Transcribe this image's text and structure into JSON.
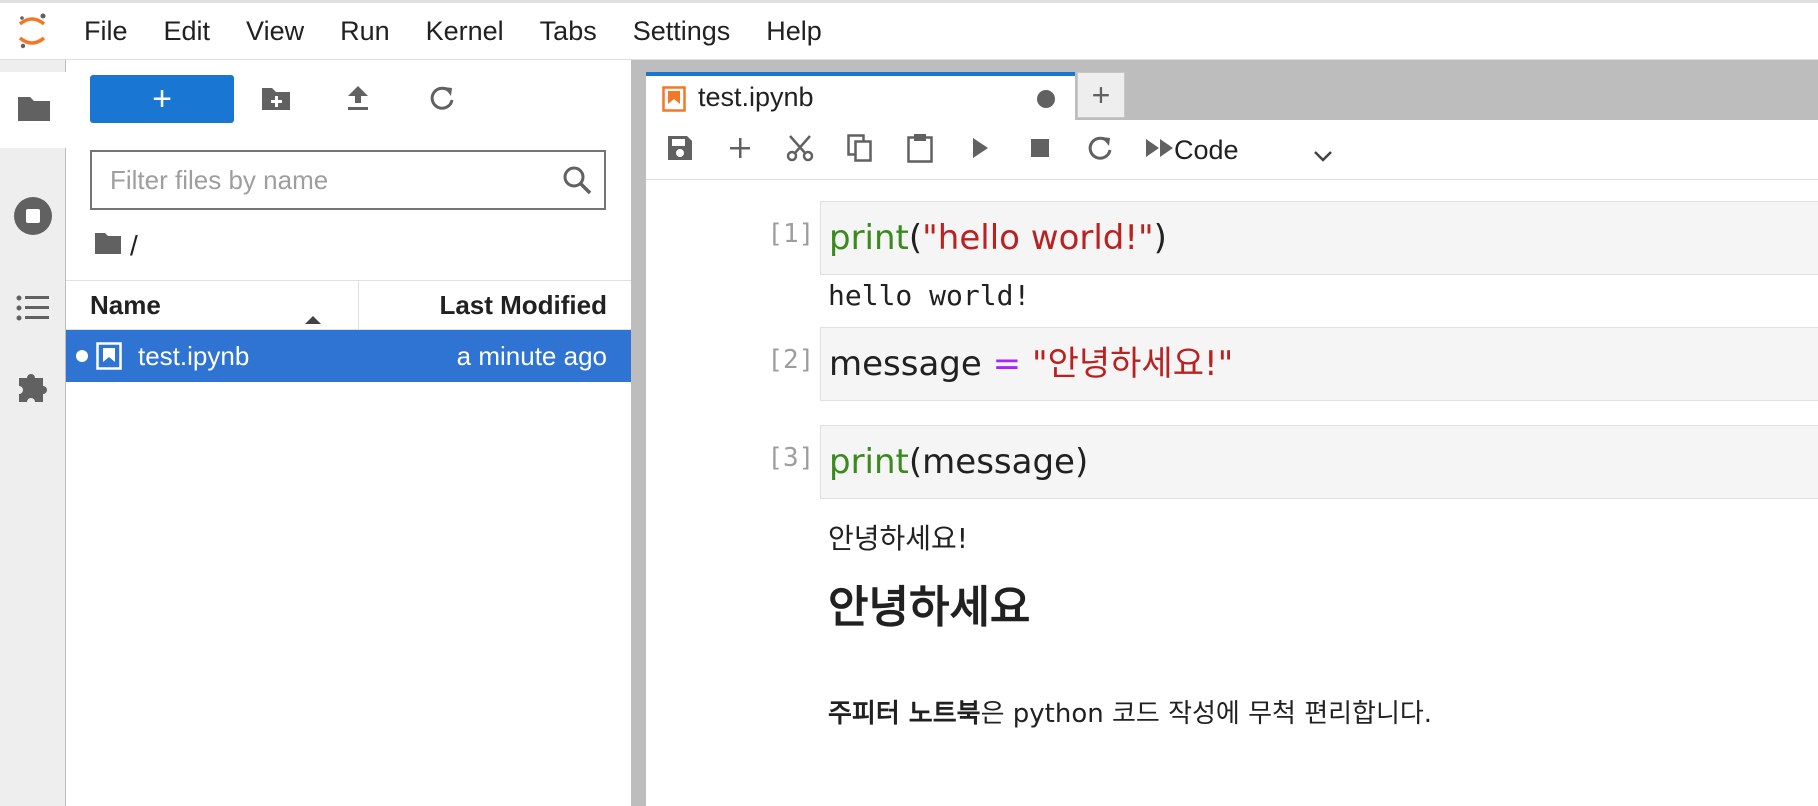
{
  "menubar": {
    "items": [
      "File",
      "Edit",
      "View",
      "Run",
      "Kernel",
      "Tabs",
      "Settings",
      "Help"
    ]
  },
  "activity_bar": {
    "icons": [
      "folder-icon",
      "running-icon",
      "toc-icon",
      "extension-icon"
    ]
  },
  "file_browser": {
    "new_label": "+",
    "filter_placeholder": "Filter files by name",
    "breadcrumb": "/",
    "columns": {
      "name": "Name",
      "modified": "Last Modified"
    },
    "files": [
      {
        "name": "test.ipynb",
        "modified": "a minute ago"
      }
    ]
  },
  "main": {
    "tab": {
      "label": "test.ipynb"
    },
    "add_tab_label": "+",
    "cell_type": "Code",
    "cells": [
      {
        "prompt": "[1]:",
        "code": {
          "func": "print",
          "open": "(",
          "arg": "\"hello world!\"",
          "close": ")"
        },
        "output": "hello world!"
      },
      {
        "prompt": "[2]:",
        "code": {
          "name": "message",
          "op": "=",
          "value": "\"안녕하세요!\""
        }
      },
      {
        "prompt": "[3]:",
        "code": {
          "func": "print",
          "args": "(message)"
        },
        "output": "안녕하세요!"
      }
    ],
    "markdown": {
      "heading": "안녕하세요",
      "bold": "주피터 노트북",
      "rest": "은 python 코드 작성에 무척 편리합니다."
    }
  },
  "colors": {
    "accent": "#1976d2",
    "selected_row": "#2f73d3",
    "keyword": "#3b8a1e",
    "string": "#ba2121",
    "operator": "#aa22ff",
    "jupyter_orange": "#f37726"
  }
}
